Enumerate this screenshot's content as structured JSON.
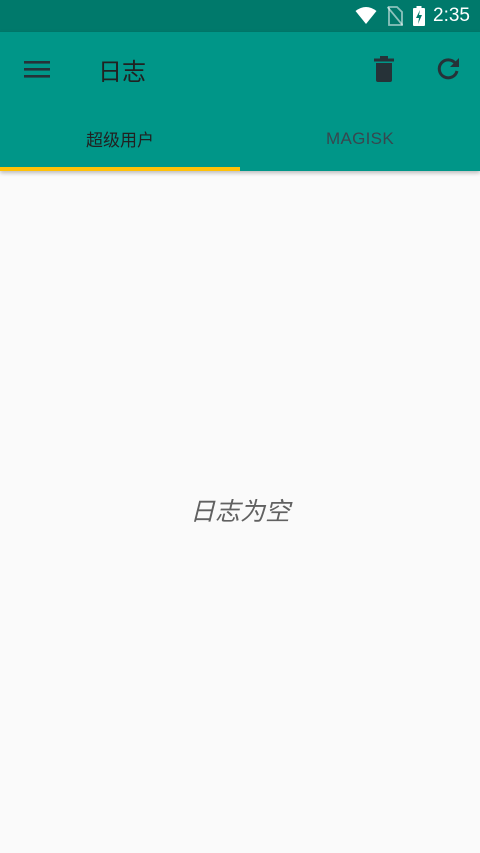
{
  "status_bar": {
    "time": "2:35",
    "icons": [
      "wifi-icon",
      "no-sim-icon",
      "battery-charging-icon"
    ],
    "color": "#00796b"
  },
  "toolbar": {
    "title": "日志",
    "menu_icon": "hamburger-menu-icon",
    "delete_icon": "trash-icon",
    "refresh_icon": "refresh-icon",
    "color": "#009688"
  },
  "tabs": [
    {
      "label": "超级用户",
      "active": true
    },
    {
      "label": "MAGISK",
      "active": false
    }
  ],
  "accent_color": "#ffc107",
  "content": {
    "empty_message": "日志为空"
  }
}
